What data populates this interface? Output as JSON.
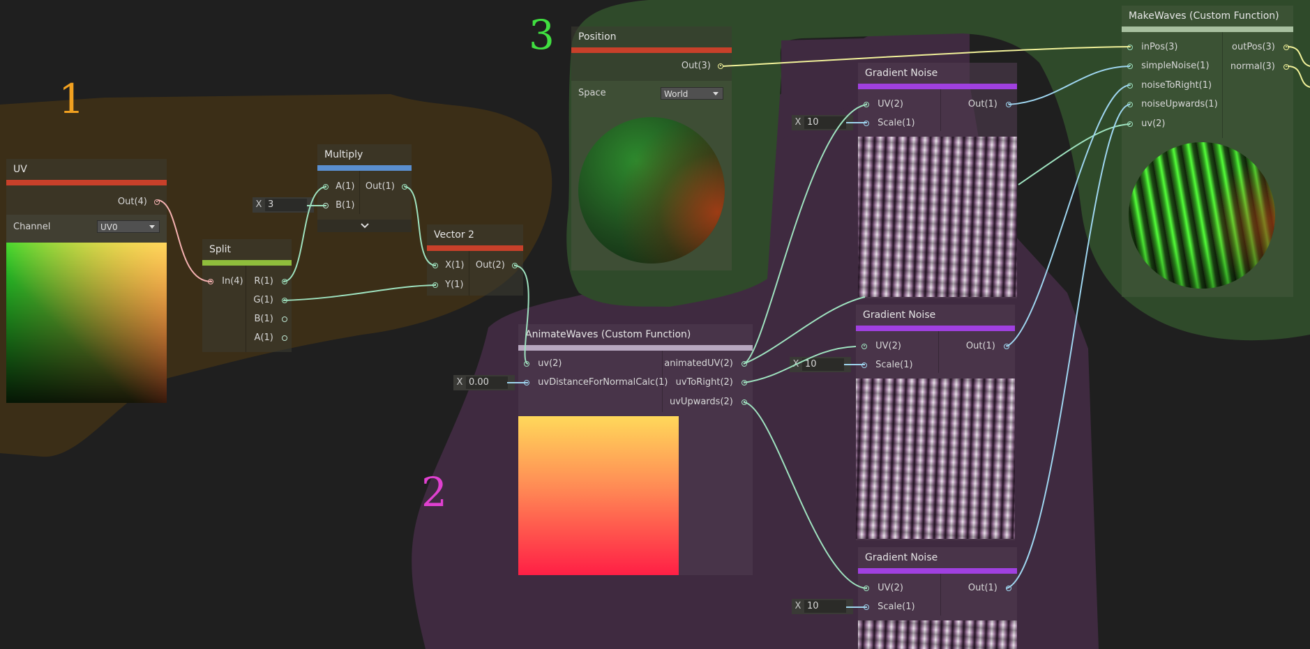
{
  "colors": {
    "region1": "#3b2e17",
    "region2": "#3f2a40",
    "region3": "#2f4a2a",
    "uv_bar": "#c8402a",
    "split_bar": "#8fbd3c",
    "multiply_bar": "#5a8fd0",
    "vector2_bar": "#c8402a",
    "position_bar": "#c8402a",
    "gradient_bar": "#a040e0",
    "animate_bar": "#b8a8c0",
    "makewaves_bar": "#a8c0a0"
  },
  "annotations": {
    "a1": "1",
    "a2": "2",
    "a3": "3"
  },
  "uv_node": {
    "title": "UV",
    "out": "Out(4)",
    "channel_label": "Channel",
    "channel_value": "UV0"
  },
  "split_node": {
    "title": "Split",
    "in": "In(4)",
    "outs": [
      "R(1)",
      "G(1)",
      "B(1)",
      "A(1)"
    ]
  },
  "multiply_node": {
    "title": "Multiply",
    "a": "A(1)",
    "b": "B(1)",
    "out": "Out(1)",
    "b_field_x": "X",
    "b_field_value": "3"
  },
  "vector2_node": {
    "title": "Vector 2",
    "x": "X(1)",
    "y": "Y(1)",
    "out": "Out(2)"
  },
  "position_node": {
    "title": "Position",
    "out": "Out(3)",
    "space_label": "Space",
    "space_value": "World"
  },
  "animate_node": {
    "title": "AnimateWaves (Custom Function)",
    "inputs": [
      "uv(2)",
      "uvDistanceForNormalCalc(1)"
    ],
    "outputs": [
      "animatedUV(2)",
      "uvToRight(2)",
      "uvUpwards(2)"
    ],
    "field_x": "X",
    "field_value": "0.00"
  },
  "gradient_nodes": [
    {
      "title": "Gradient Noise",
      "uv": "UV(2)",
      "scale": "Scale(1)",
      "out": "Out(1)",
      "field_x": "X",
      "field_value": "10"
    },
    {
      "title": "Gradient Noise",
      "uv": "UV(2)",
      "scale": "Scale(1)",
      "out": "Out(1)",
      "field_x": "X",
      "field_value": "10"
    },
    {
      "title": "Gradient Noise",
      "uv": "UV(2)",
      "scale": "Scale(1)",
      "out": "Out(1)",
      "field_x": "X",
      "field_value": "10"
    }
  ],
  "makewaves_node": {
    "title": "MakeWaves (Custom Function)",
    "inputs": [
      "inPos(3)",
      "simpleNoise(1)",
      "noiseToRight(1)",
      "noiseUpwards(1)",
      "uv(2)"
    ],
    "outputs": [
      "outPos(3)",
      "normal(3)"
    ]
  }
}
